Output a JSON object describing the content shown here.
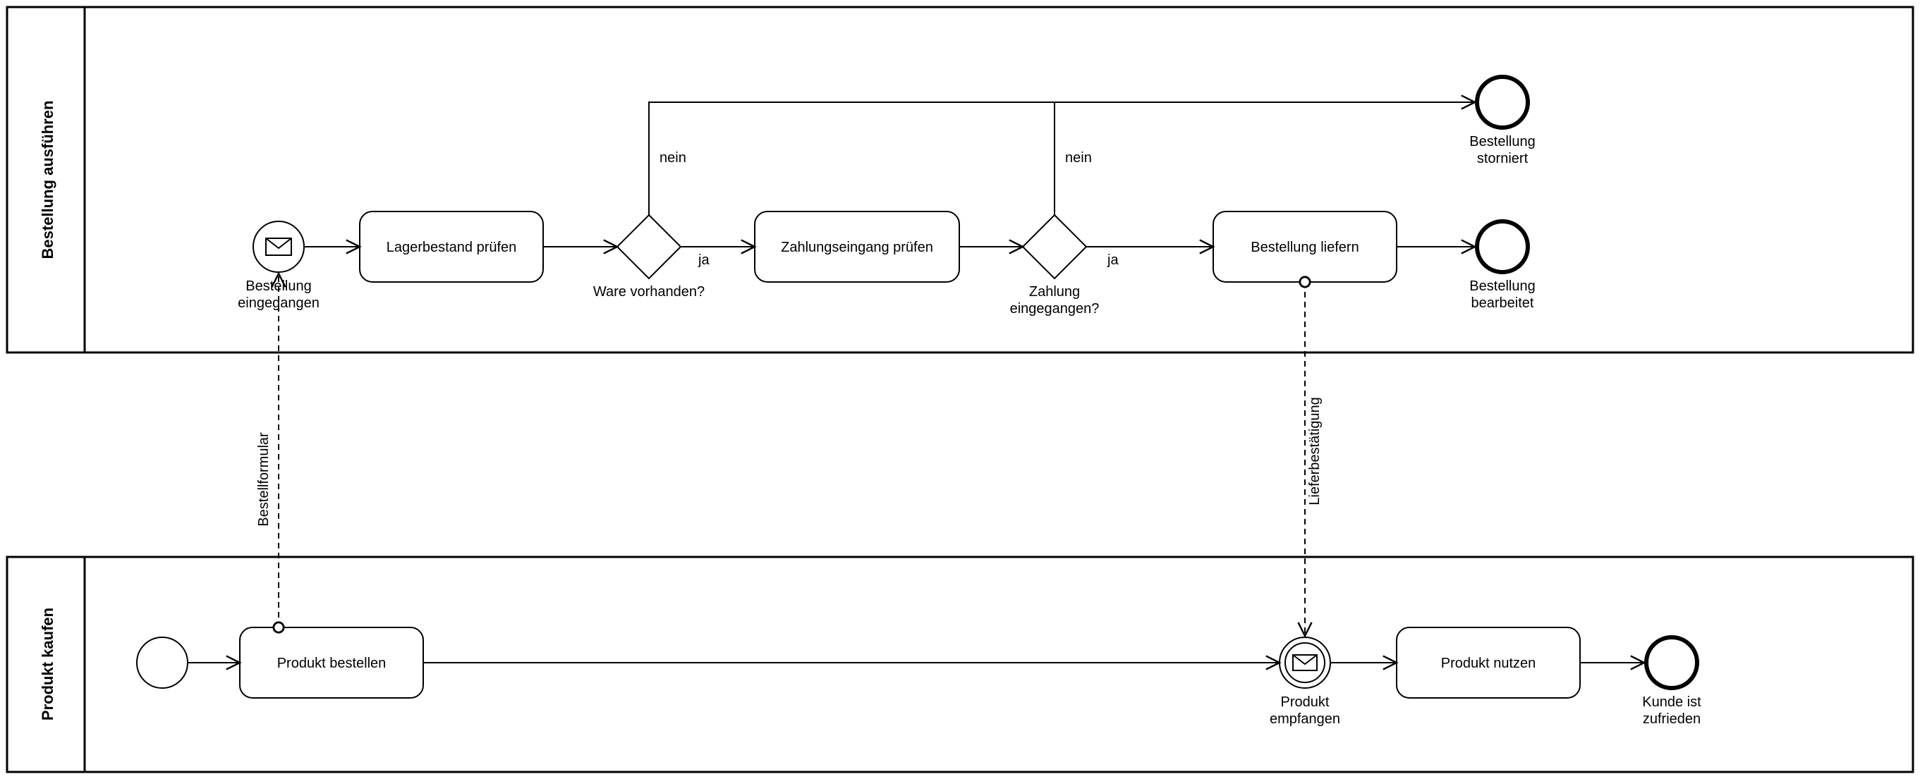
{
  "pools": {
    "top": {
      "label": "Bestellung ausführen"
    },
    "bottom": {
      "label": "Produkt kaufen"
    }
  },
  "top": {
    "start": {
      "label1": "Bestellung",
      "label2": "eingegangen"
    },
    "task1": {
      "label": "Lagerbestand prüfen"
    },
    "gw1": {
      "label": "Ware vorhanden?"
    },
    "task2": {
      "label": "Zahlungseingang prüfen"
    },
    "gw2": {
      "label1": "Zahlung",
      "label2": "eingegangen?"
    },
    "task3": {
      "label": "Bestellung liefern"
    },
    "end1": {
      "label1": "Bestellung",
      "label2": "storniert"
    },
    "end2": {
      "label1": "Bestellung",
      "label2": "bearbeitet"
    },
    "yes": "ja",
    "no": "nein"
  },
  "bottom": {
    "task1": {
      "label": "Produkt bestellen"
    },
    "recv": {
      "label1": "Produkt",
      "label2": "empfangen"
    },
    "task2": {
      "label": "Produkt nutzen"
    },
    "end": {
      "label1": "Kunde ist",
      "label2": "zufrieden"
    }
  },
  "messages": {
    "order": "Bestellformular",
    "delivery": "Lieferbestätigung"
  }
}
